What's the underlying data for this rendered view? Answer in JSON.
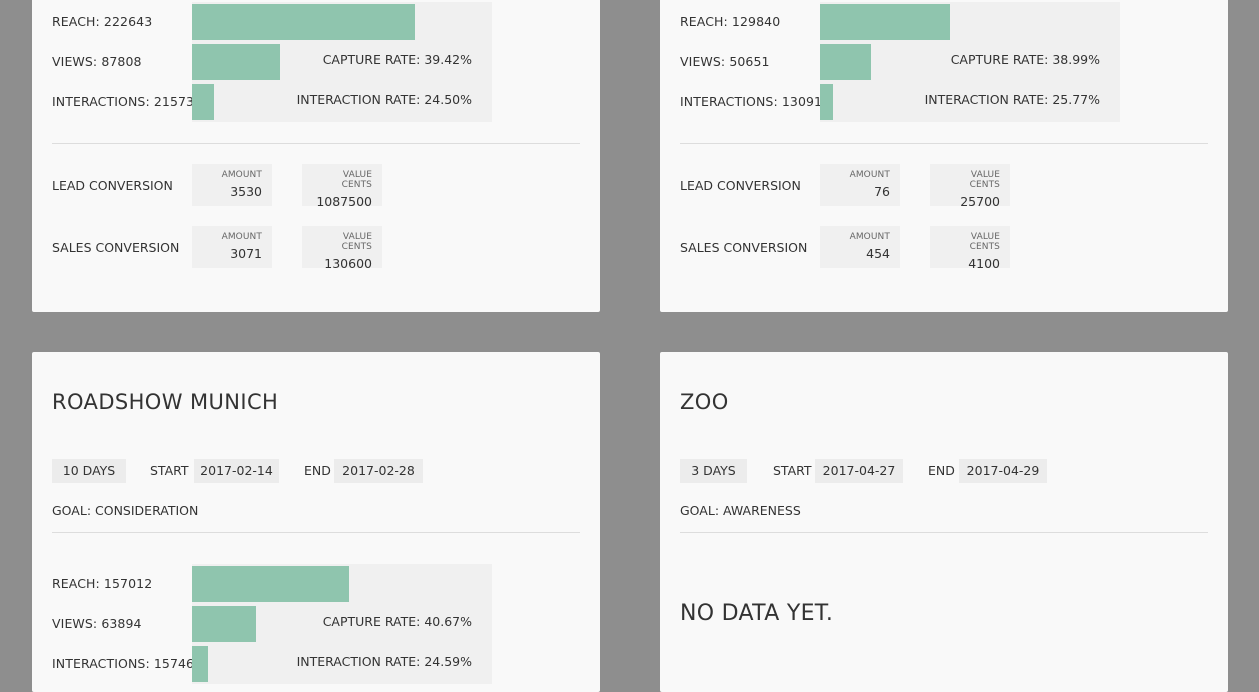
{
  "colors": {
    "background": "#8e8e8e",
    "card": "#f9f9f9",
    "bar": "#8fc5ae",
    "bar_track": "#f0f0f0",
    "chip": "#ececec"
  },
  "cards": [
    {
      "metrics": {
        "reach_label": "REACH: 222643",
        "reach_fill_fraction": 0.743,
        "views_label": "VIEWS: 87808",
        "views_fill_fraction": 0.293,
        "capture_rate": "CAPTURE RATE: 39.42%",
        "interactions_label": "INTERACTIONS: 21573",
        "interactions_fill_fraction": 0.073,
        "interaction_rate": "INTERACTION RATE: 24.50%"
      },
      "conversions": [
        {
          "label": "LEAD CONVERSION",
          "amount_caption": "AMOUNT",
          "amount": "3530",
          "value_caption": "VALUE CENTS",
          "value": "1087500"
        },
        {
          "label": "SALES CONVERSION",
          "amount_caption": "AMOUNT",
          "amount": "3071",
          "value_caption": "VALUE CENTS",
          "value": "130600"
        }
      ]
    },
    {
      "metrics": {
        "reach_label": "REACH: 129840",
        "reach_fill_fraction": 0.433,
        "views_label": "VIEWS: 50651",
        "views_fill_fraction": 0.17,
        "capture_rate": "CAPTURE RATE: 38.99%",
        "interactions_label": "INTERACTIONS: 13091",
        "interactions_fill_fraction": 0.043,
        "interaction_rate": "INTERACTION RATE: 25.77%"
      },
      "conversions": [
        {
          "label": "LEAD CONVERSION",
          "amount_caption": "AMOUNT",
          "amount": "76",
          "value_caption": "VALUE CENTS",
          "value": "25700"
        },
        {
          "label": "SALES CONVERSION",
          "amount_caption": "AMOUNT",
          "amount": "454",
          "value_caption": "VALUE CENTS",
          "value": "4100"
        }
      ]
    },
    {
      "title": "ROADSHOW MUNICH",
      "duration": "10 DAYS",
      "start_label": "START",
      "start_date": "2017-02-14",
      "end_label": "END",
      "end_date": "2017-02-28",
      "goal": "GOAL: CONSIDERATION",
      "metrics": {
        "reach_label": "REACH: 157012",
        "reach_fill_fraction": 0.523,
        "views_label": "VIEWS: 63894",
        "views_fill_fraction": 0.213,
        "capture_rate": "CAPTURE RATE: 40.67%",
        "interactions_label": "INTERACTIONS: 15746",
        "interactions_fill_fraction": 0.053,
        "interaction_rate": "INTERACTION RATE: 24.59%"
      }
    },
    {
      "title": "ZOO",
      "duration": "3 DAYS",
      "start_label": "START",
      "start_date": "2017-04-27",
      "end_label": "END",
      "end_date": "2017-04-29",
      "goal": "GOAL: AWARENESS",
      "no_data": "NO DATA YET."
    }
  ]
}
